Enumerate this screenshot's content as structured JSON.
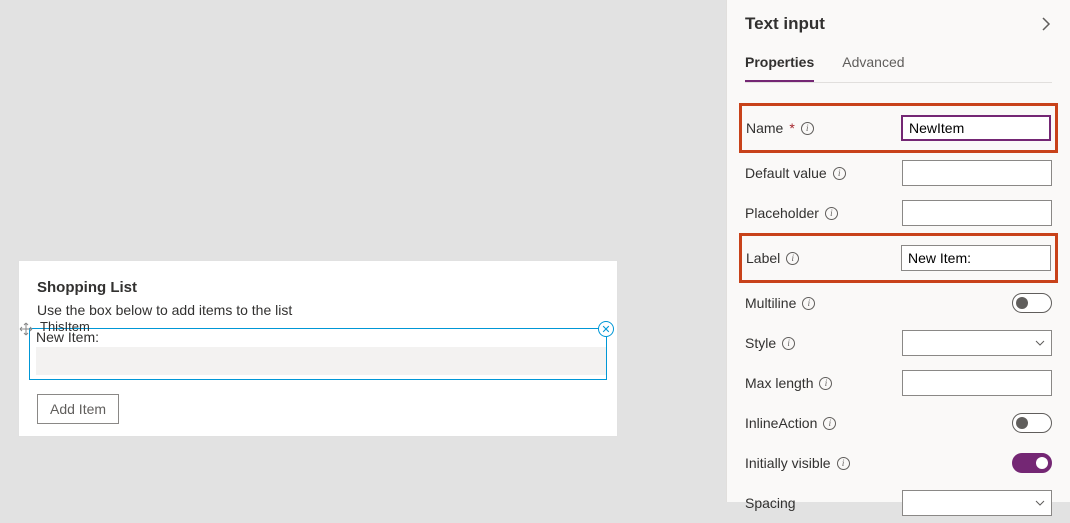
{
  "canvas": {
    "card_title": "Shopping List",
    "card_desc": "Use the box below to add items to the list",
    "selected_control_name": "ThisItem",
    "item_label": "New Item:",
    "add_button_label": "Add Item"
  },
  "panel": {
    "title": "Text input",
    "tabs": {
      "properties": "Properties",
      "advanced": "Advanced"
    },
    "props": {
      "name_label": "Name",
      "name_value": "NewItem",
      "default_value_label": "Default value",
      "default_value": "",
      "placeholder_label": "Placeholder",
      "placeholder_value": "",
      "label_label": "Label",
      "label_value": "New Item:",
      "multiline_label": "Multiline",
      "style_label": "Style",
      "maxlength_label": "Max length",
      "maxlength_value": "",
      "inlineaction_label": "InlineAction",
      "initiallyvisible_label": "Initially visible",
      "spacing_label": "Spacing"
    }
  }
}
